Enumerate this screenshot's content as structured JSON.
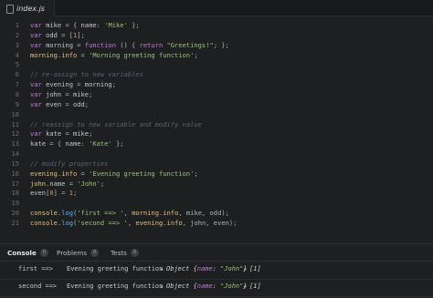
{
  "tab": {
    "title": "index.js",
    "icon": "file-icon"
  },
  "code_lines": [
    {
      "n": "1",
      "tokens": [
        [
          "kw",
          "var"
        ],
        [
          "id",
          " mike "
        ],
        [
          "op",
          "= { "
        ],
        [
          "id",
          "name"
        ],
        [
          "op",
          ": "
        ],
        [
          "str",
          "'Mike'"
        ],
        [
          "op",
          " };"
        ]
      ]
    },
    {
      "n": "2",
      "tokens": [
        [
          "kw",
          "var"
        ],
        [
          "id",
          " odd "
        ],
        [
          "op",
          "= ["
        ],
        [
          "num",
          "1"
        ],
        [
          "op",
          "];"
        ]
      ]
    },
    {
      "n": "3",
      "tokens": [
        [
          "kw",
          "var"
        ],
        [
          "id",
          " morning "
        ],
        [
          "op",
          "= "
        ],
        [
          "kw",
          "function"
        ],
        [
          "op",
          " () { "
        ],
        [
          "kw",
          "return"
        ],
        [
          "op",
          " "
        ],
        [
          "str",
          "\"Greetings!\""
        ],
        [
          "op",
          "; };"
        ]
      ]
    },
    {
      "n": "4",
      "tokens": [
        [
          "prop",
          "morning"
        ],
        [
          "op",
          "."
        ],
        [
          "prop",
          "info"
        ],
        [
          "op",
          " = "
        ],
        [
          "str",
          "'Morning greeting function'"
        ],
        [
          "op",
          ";"
        ]
      ]
    },
    {
      "n": "5",
      "tokens": []
    },
    {
      "n": "6",
      "tokens": [
        [
          "cm",
          "// re-assign to new variables"
        ]
      ]
    },
    {
      "n": "7",
      "tokens": [
        [
          "kw",
          "var"
        ],
        [
          "id",
          " evening "
        ],
        [
          "op",
          "= "
        ],
        [
          "id",
          "morning"
        ],
        [
          "op",
          ";"
        ]
      ]
    },
    {
      "n": "8",
      "tokens": [
        [
          "kw",
          "var"
        ],
        [
          "id",
          " john "
        ],
        [
          "op",
          "= "
        ],
        [
          "id",
          "mike"
        ],
        [
          "op",
          ";"
        ]
      ]
    },
    {
      "n": "9",
      "tokens": [
        [
          "kw",
          "var"
        ],
        [
          "id",
          " even "
        ],
        [
          "op",
          "= "
        ],
        [
          "id",
          "odd"
        ],
        [
          "op",
          ";"
        ]
      ]
    },
    {
      "n": "10",
      "tokens": []
    },
    {
      "n": "11",
      "tokens": [
        [
          "cm",
          "// reassign to new variable and modify value"
        ]
      ]
    },
    {
      "n": "12",
      "tokens": [
        [
          "kw",
          "var"
        ],
        [
          "id",
          " kate "
        ],
        [
          "op",
          "= "
        ],
        [
          "id",
          "mike"
        ],
        [
          "op",
          ";"
        ]
      ]
    },
    {
      "n": "13",
      "tokens": [
        [
          "id",
          "kate "
        ],
        [
          "op",
          "= { "
        ],
        [
          "id",
          "name"
        ],
        [
          "op",
          ": "
        ],
        [
          "str",
          "'Kate'"
        ],
        [
          "op",
          " };"
        ]
      ]
    },
    {
      "n": "14",
      "tokens": []
    },
    {
      "n": "15",
      "tokens": [
        [
          "cm",
          "// modify properties"
        ]
      ]
    },
    {
      "n": "16",
      "tokens": [
        [
          "prop",
          "evening"
        ],
        [
          "op",
          "."
        ],
        [
          "prop",
          "info"
        ],
        [
          "op",
          " = "
        ],
        [
          "str",
          "'Evening greeting function'"
        ],
        [
          "op",
          ";"
        ]
      ]
    },
    {
      "n": "17",
      "tokens": [
        [
          "prop",
          "john"
        ],
        [
          "op",
          "."
        ],
        [
          "id",
          "name"
        ],
        [
          "op",
          " = "
        ],
        [
          "str",
          "'John'"
        ],
        [
          "op",
          ";"
        ]
      ]
    },
    {
      "n": "18",
      "tokens": [
        [
          "id",
          "even"
        ],
        [
          "op",
          "["
        ],
        [
          "num",
          "0"
        ],
        [
          "op",
          "] = "
        ],
        [
          "num",
          "1"
        ],
        [
          "op",
          ";"
        ]
      ]
    },
    {
      "n": "19",
      "tokens": []
    },
    {
      "n": "20",
      "tokens": [
        [
          "prop",
          "console"
        ],
        [
          "op",
          "."
        ],
        [
          "fn",
          "log"
        ],
        [
          "op",
          "("
        ],
        [
          "str",
          "'first ==> '"
        ],
        [
          "op",
          ", "
        ],
        [
          "prop",
          "morning"
        ],
        [
          "op",
          "."
        ],
        [
          "prop",
          "info"
        ],
        [
          "op",
          ", mike, odd);"
        ]
      ]
    },
    {
      "n": "21",
      "tokens": [
        [
          "prop",
          "console"
        ],
        [
          "op",
          "."
        ],
        [
          "fn",
          "log"
        ],
        [
          "op",
          "("
        ],
        [
          "str",
          "'second ==> '"
        ],
        [
          "op",
          ", "
        ],
        [
          "prop",
          "evening"
        ],
        [
          "op",
          "."
        ],
        [
          "prop",
          "info"
        ],
        [
          "op",
          ", john, even);"
        ]
      ]
    }
  ],
  "panel_tabs": [
    {
      "label": "Console",
      "count": "0",
      "active": true
    },
    {
      "label": "Problems",
      "count": "0",
      "active": false
    },
    {
      "label": "Tests",
      "count": "0",
      "active": false
    }
  ],
  "console_rows": [
    {
      "label": "first ==>",
      "message": "Evening greeting function",
      "obj_prefix": "Object {",
      "obj_key": "name",
      "obj_sep": ": ",
      "obj_val": "\"John\"",
      "obj_suffix": "}",
      "array": "[1]"
    },
    {
      "label": "second ==>",
      "message": "Evening greeting function",
      "obj_prefix": "Object {",
      "obj_key": "name",
      "obj_sep": ": ",
      "obj_val": "\"John\"",
      "obj_suffix": "}",
      "array": "[1]"
    }
  ],
  "colors": {
    "background": "#1d1f21",
    "keyword": "#c678dd",
    "string": "#98c379",
    "property": "#e5c07b",
    "number": "#d19a66",
    "comment": "#5c6370",
    "function": "#61afef"
  }
}
